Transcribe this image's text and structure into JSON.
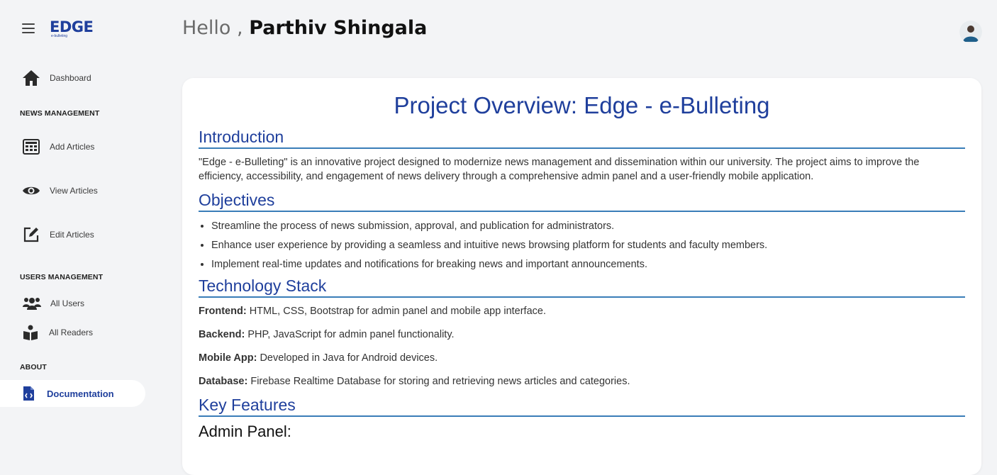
{
  "sidebar": {
    "logo_text": "EDGE",
    "logo_subtext": "e-bulleting",
    "dashboard": "Dashboard",
    "news_section": "NEWS MANAGEMENT",
    "add_articles": "Add Articles",
    "view_articles": "View Articles",
    "edit_articles": "Edit Articles",
    "users_section": "USERS MANAGEMENT",
    "all_users": "All Users",
    "all_readers": "All Readers",
    "about_section": "ABOUT",
    "documentation": "Documentation"
  },
  "header": {
    "greeting": "Hello ,",
    "user_name": "Parthiv Shingala"
  },
  "doc": {
    "title": "Project Overview: Edge - e-Bulleting",
    "intro_heading": "Introduction",
    "intro_text": "\"Edge - e-Bulleting\" is an innovative project designed to modernize news management and dissemination within our university. The project aims to improve the efficiency, accessibility, and engagement of news delivery through a comprehensive admin panel and a user-friendly mobile application.",
    "objectives_heading": "Objectives",
    "objectives": [
      "Streamline the process of news submission, approval, and publication for administrators.",
      "Enhance user experience by providing a seamless and intuitive news browsing platform for students and faculty members.",
      "Implement real-time updates and notifications for breaking news and important announcements."
    ],
    "tech_heading": "Technology Stack",
    "tech": [
      {
        "label": "Frontend:",
        "text": "HTML, CSS, Bootstrap for admin panel and mobile app interface."
      },
      {
        "label": "Backend:",
        "text": "PHP, JavaScript for admin panel functionality."
      },
      {
        "label": "Mobile App:",
        "text": "Developed in Java for Android devices."
      },
      {
        "label": "Database:",
        "text": "Firebase Realtime Database for storing and retrieving news articles and categories."
      }
    ],
    "features_heading": "Key Features",
    "admin_panel_heading": "Admin Panel:"
  },
  "colors": {
    "accent": "#1f3f9c",
    "rule": "#3a7db8",
    "background": "#f3f4f6"
  }
}
